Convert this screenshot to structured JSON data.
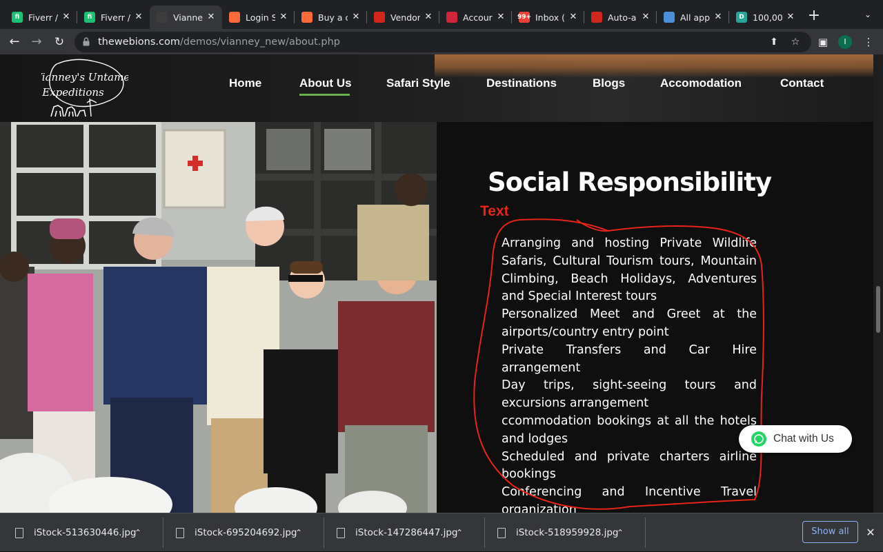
{
  "browser": {
    "tabs": [
      {
        "title": "Fiverr /",
        "favicon": "fiverr-icon",
        "color": "#1dbf73",
        "glyph": "fi"
      },
      {
        "title": "Fiverr /",
        "favicon": "fiverr-icon",
        "color": "#1dbf73",
        "glyph": "fi"
      },
      {
        "title": "Vianne",
        "favicon": "vianney-icon",
        "color": "#3c3c3c",
        "glyph": "",
        "active": true
      },
      {
        "title": "Login S",
        "favicon": "envato-icon",
        "color": "#ff6a3d",
        "glyph": ""
      },
      {
        "title": "Buy a c",
        "favicon": "envato-icon",
        "color": "#ff6a3d",
        "glyph": ""
      },
      {
        "title": "Vendor",
        "favicon": "africa-map-icon",
        "color": "#d0261c",
        "glyph": ""
      },
      {
        "title": "Accour",
        "favicon": "account-icon",
        "color": "#d0263b",
        "glyph": ""
      },
      {
        "title": "Inbox (",
        "favicon": "gmail-icon",
        "color": "#ea4335",
        "glyph": "99+"
      },
      {
        "title": "Auto-a",
        "favicon": "africa-map-icon",
        "color": "#d0261c",
        "glyph": ""
      },
      {
        "title": "All app",
        "favicon": "app-store-icon",
        "color": "#4a90d9",
        "glyph": ""
      },
      {
        "title": "100,00",
        "favicon": "d-icon",
        "color": "#26a69a",
        "glyph": "D"
      }
    ],
    "url_host": "thewebions.com",
    "url_path": "/demos/vianney_new/about.php",
    "profile_initial": "I"
  },
  "site": {
    "logo_text": "Vianney's Untamed Expeditions",
    "nav": [
      "Home",
      "About Us",
      "Safari Style",
      "Destinations",
      "Blogs",
      "Accomodation",
      "Contact"
    ],
    "active_nav": "About Us",
    "accent_color": "#6ab04c"
  },
  "section": {
    "heading": "Social Responsibility",
    "annotation_label": "Text",
    "annotation_color": "#e8231a",
    "services": [
      "Arranging and hosting Private Wildlife Safaris, Cultural Tourism tours, Mountain Climbing, Beach Holidays, Adventures and Special Interest tours",
      "Personalized Meet and Greet at the airports/country entry point",
      "Private Transfers and Car Hire arrangement",
      "Day trips, sight-seeing tours and excursions arrangement",
      "ccommodation bookings at all the hotels and lodges",
      "Scheduled and private charters airline bookings",
      "Conferencing and Incentive Travel organization"
    ]
  },
  "chat": {
    "label": "Chat with Us"
  },
  "downloads": {
    "files": [
      "iStock-513630446.jpg",
      "iStock-695204692.jpg",
      "iStock-147286447.jpg",
      "iStock-518959928.jpg"
    ],
    "show_all": "Show all"
  }
}
